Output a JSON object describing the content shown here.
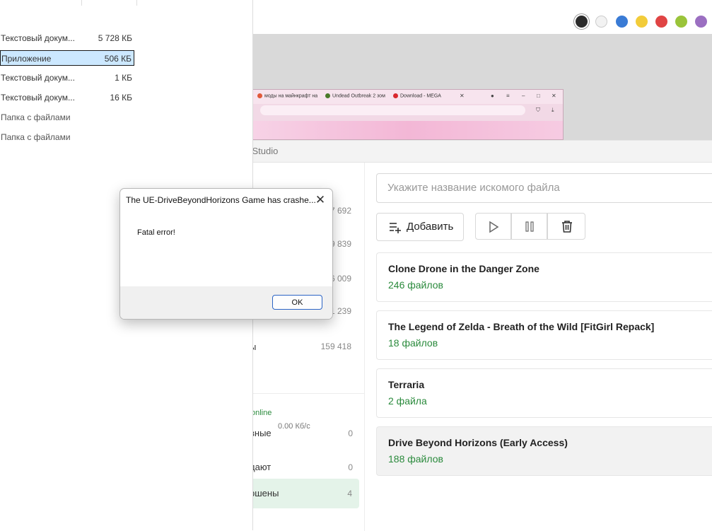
{
  "palette": {
    "colors": [
      "#2b2b2b",
      "#f2f2f2",
      "#3a7bd5",
      "#f2cc3a",
      "#e04444",
      "#9ac43a",
      "#9b6fc1"
    ]
  },
  "browser_thumb": {
    "tabs": [
      {
        "label": "моды на майнкрафт на",
        "color": "#e05a3a"
      },
      {
        "label": "Undead Outbreak 2 зом",
        "color": "#4a7a2a"
      },
      {
        "label": "Download - MEGA",
        "color": "#d9272e"
      }
    ]
  },
  "explorer": {
    "files": [
      {
        "name": "Текстовый докум...",
        "size": "5 728 КБ",
        "selected": false,
        "folder": false
      },
      {
        "name": "Приложение",
        "size": "506 КБ",
        "selected": true,
        "folder": false
      },
      {
        "name": "Текстовый докум...",
        "size": "1 КБ",
        "selected": false,
        "folder": false
      },
      {
        "name": "Текстовый докум...",
        "size": "16 КБ",
        "selected": false,
        "folder": false
      },
      {
        "name": "Папка с файлами",
        "size": "",
        "selected": false,
        "folder": true
      },
      {
        "name": "Папка с файлами",
        "size": "",
        "selected": false,
        "folder": true
      }
    ]
  },
  "torrent": {
    "title": "l Studio",
    "sidebar_numbers": [
      "7 692",
      "9 839",
      "6 009",
      "1 239"
    ],
    "sidebar_last": {
      "label": "ы",
      "count": "159 418"
    },
    "online_label": "online",
    "rows": [
      {
        "label": "вные",
        "speed": "0.00 Кб/с",
        "count": "0"
      },
      {
        "label": "дают",
        "speed": "",
        "count": "0"
      },
      {
        "label": "ршены",
        "speed": "",
        "count": "4"
      }
    ],
    "search_placeholder": "Укажите название искомого файла",
    "add_label": "Добавить",
    "items": [
      {
        "name": "Clone Drone in the Danger Zone",
        "files": "246 файлов"
      },
      {
        "name": "The Legend of Zelda - Breath of the Wild [FitGirl Repack]",
        "files": "18 файлов"
      },
      {
        "name": "Terraria",
        "files": "2 файла"
      },
      {
        "name": "Drive Beyond Horizons (Early Access)",
        "files": "188 файлов"
      }
    ]
  },
  "dialog": {
    "title": "The UE-DriveBeyondHorizons Game has crashe...",
    "message": "Fatal error!",
    "ok_label": "OK"
  }
}
